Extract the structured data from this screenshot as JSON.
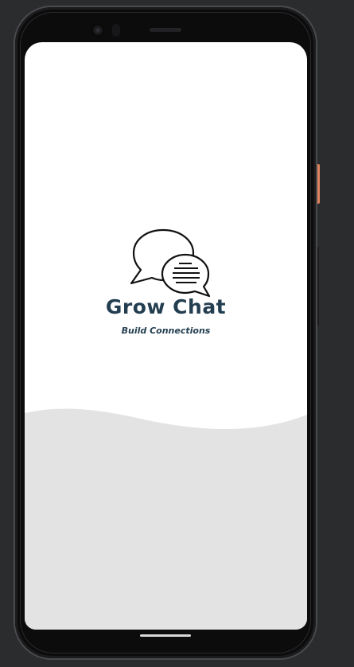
{
  "app": {
    "title": "Grow Chat",
    "tagline": "Build Connections"
  },
  "icons": {
    "logo": "chat-bubbles-icon"
  },
  "colors": {
    "background": "#2b2c2e",
    "screen": "#ffffff",
    "wave": "#e3e3e3",
    "brand_text": "#233e50",
    "side_button_accent": "#e0825d"
  }
}
